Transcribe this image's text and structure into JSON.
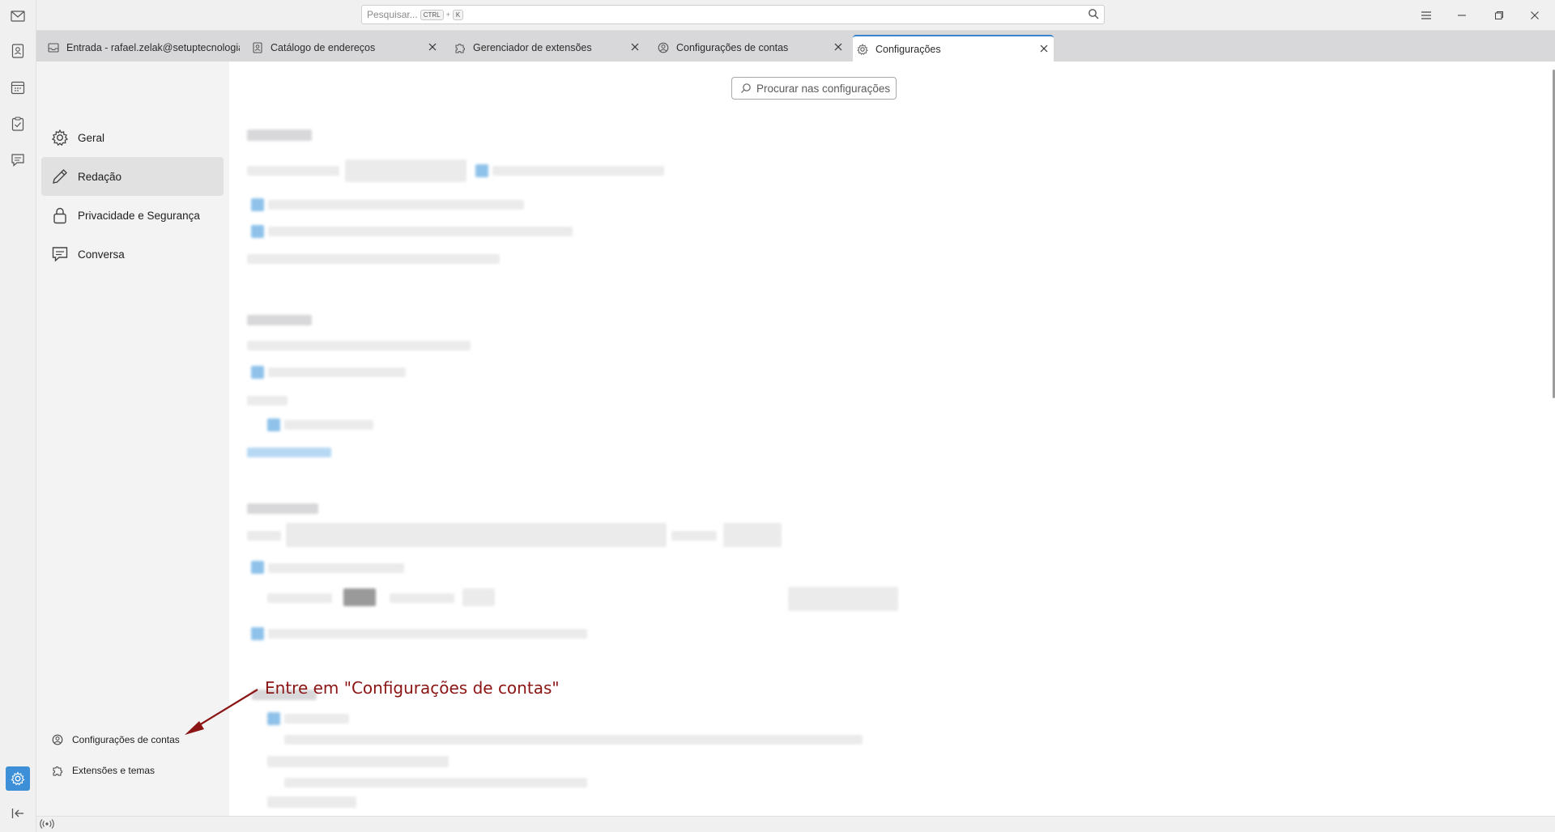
{
  "search": {
    "placeholder": "Pesquisar...",
    "kbd_ctrl": "CTRL",
    "kbd_plus": "+",
    "kbd_key": "K"
  },
  "tabs": [
    {
      "label": "Entrada - rafael.zelak@setuptecnologia",
      "icon": "inbox-icon"
    },
    {
      "label": "Catálogo de endereços",
      "icon": "address-book-icon"
    },
    {
      "label": "Gerenciador de extensões",
      "icon": "puzzle-icon"
    },
    {
      "label": "Configurações de contas",
      "icon": "account-settings-icon"
    },
    {
      "label": "Configurações",
      "icon": "gear-icon"
    }
  ],
  "sidebar": {
    "items": [
      {
        "label": "Geral",
        "icon": "gear-icon"
      },
      {
        "label": "Redação",
        "icon": "pencil-icon"
      },
      {
        "label": "Privacidade e Segurança",
        "icon": "lock-icon"
      },
      {
        "label": "Conversa",
        "icon": "chat-icon"
      }
    ],
    "footer": [
      {
        "label": "Configurações de contas",
        "icon": "account-settings-icon"
      },
      {
        "label": "Extensões e temas",
        "icon": "puzzle-icon"
      }
    ]
  },
  "content": {
    "search_placeholder": "Procurar nas configurações"
  },
  "annotation": {
    "text": "Entre em \"Configurações de contas\"",
    "color": "#8b1414"
  },
  "colors": {
    "accent": "#3a84cf",
    "active_space": "#3d90d8"
  }
}
